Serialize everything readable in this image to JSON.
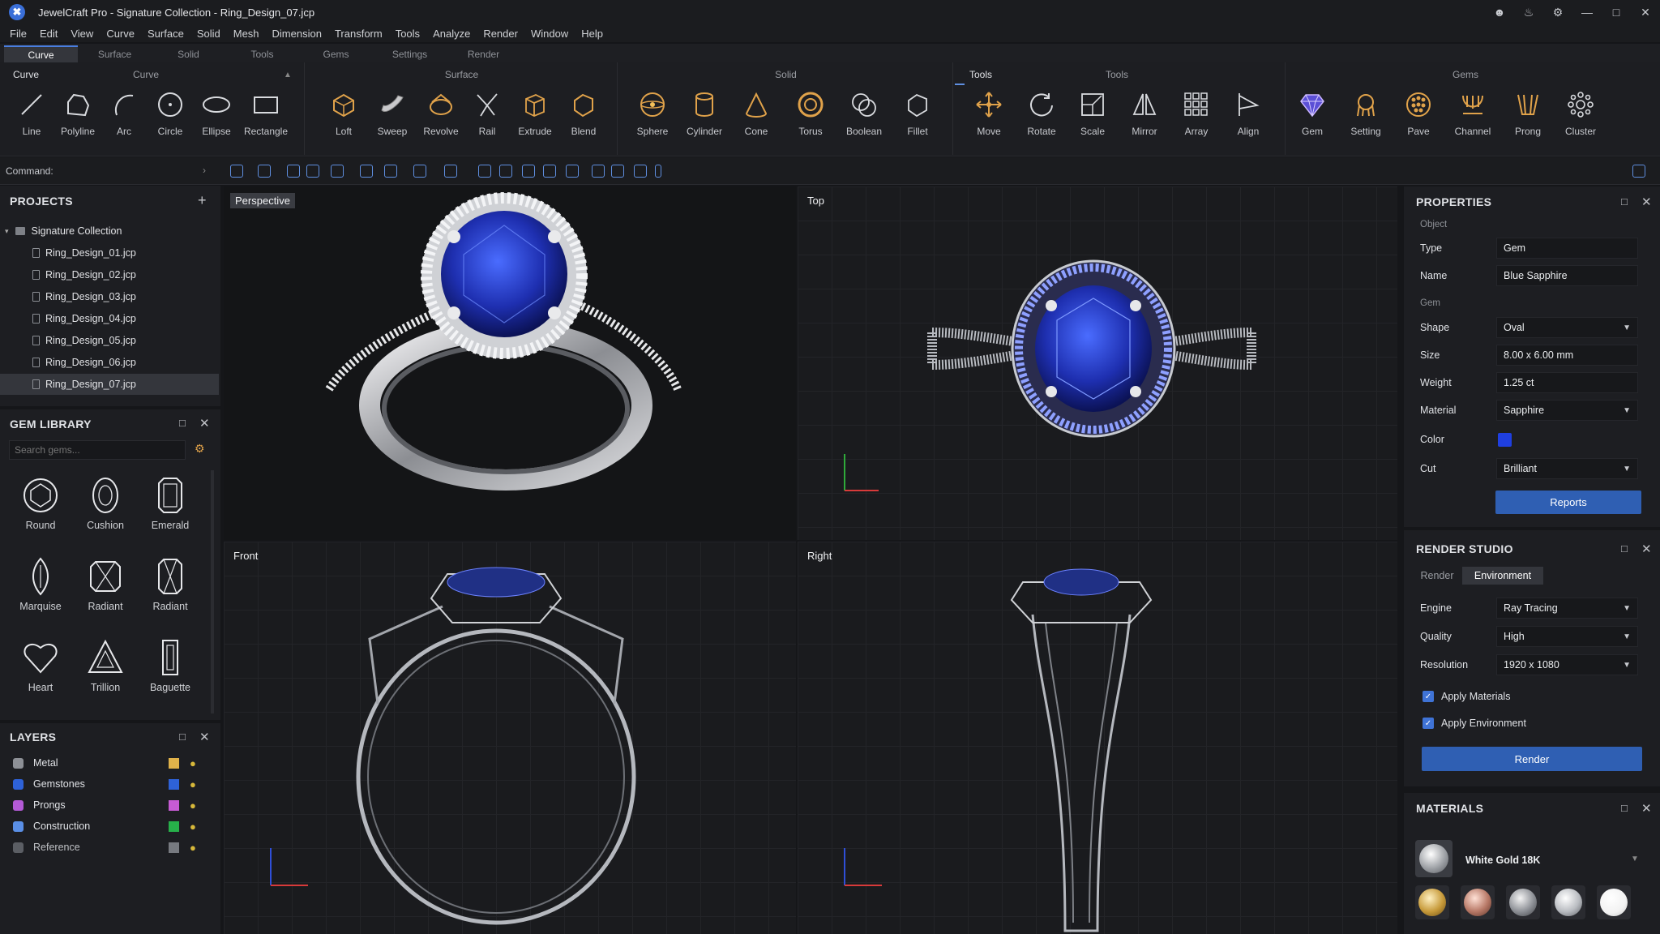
{
  "app": {
    "window_title": "JewelCraft Pro - Signature Collection - Ring_Design_07.jcp",
    "logo_icon": "jewelcraft-logo-icon"
  },
  "menu": [
    "File",
    "Edit",
    "View",
    "Curve",
    "Surface",
    "Solid",
    "Mesh",
    "Dimension",
    "Transform",
    "Tools",
    "Analyze",
    "Render",
    "Window",
    "Help"
  ],
  "ribbon_tabs": [
    {
      "label": "Curve",
      "active": true
    },
    {
      "label": "Surface"
    },
    {
      "label": "Solid"
    },
    {
      "label": "Tools"
    },
    {
      "label": "Gems"
    },
    {
      "label": "Settings"
    },
    {
      "label": "Render"
    }
  ],
  "ribbon": {
    "curve_tab": "Curve",
    "curve_title": "Curve",
    "curve": [
      "Line",
      "Polyline",
      "Arc",
      "Circle",
      "Ellipse",
      "Rectangle"
    ],
    "surface_title": "Surface",
    "surface": [
      "Loft",
      "Sweep",
      "Revolve",
      "Rail",
      "Extrude",
      "Blend"
    ],
    "solid_title": "Solid",
    "solid": [
      "Sphere",
      "Cylinder",
      "Cone",
      "Torus",
      "Boolean",
      "Fillet"
    ],
    "tools_tab": "Tools",
    "tools_title": "Tools",
    "tools": [
      "Move",
      "Rotate",
      "Scale",
      "Mirror",
      "Array",
      "Align"
    ],
    "gems_title": "Gems",
    "gems": [
      "Gem",
      "Setting",
      "Pave",
      "Channel",
      "Prong",
      "Cluster"
    ]
  },
  "command": {
    "label": "Command:"
  },
  "projects": {
    "title": "PROJECTS",
    "collection": "Signature Collection",
    "files": [
      "Ring_Design_01.jcp",
      "Ring_Design_02.jcp",
      "Ring_Design_03.jcp",
      "Ring_Design_04.jcp",
      "Ring_Design_05.jcp",
      "Ring_Design_06.jcp",
      "Ring_Design_07.jcp"
    ],
    "selected_index": 6
  },
  "gem_library": {
    "title": "GEM LIBRARY",
    "search_placeholder": "Search gems...",
    "gems": [
      "Round",
      "Cushion",
      "Emerald",
      "Marquise",
      "Radiant",
      "Radiant",
      "Heart",
      "Trillion",
      "Baguette"
    ]
  },
  "layers": {
    "title": "LAYERS",
    "items": [
      {
        "name": "Metal",
        "color": "#e0b24a",
        "dot": "#8d9096"
      },
      {
        "name": "Gemstones",
        "color": "#2e62d8",
        "dot": "#2e62d8"
      },
      {
        "name": "Prongs",
        "color": "#c65bd4",
        "dot": "#b35ad6"
      },
      {
        "name": "Construction",
        "color": "#27b04a",
        "dot": "#5a8fe6"
      },
      {
        "name": "Reference",
        "color": "#777a80",
        "dot": "#5b5e64"
      }
    ]
  },
  "viewports": {
    "perspective": "Perspective",
    "top": "Top",
    "front": "Front",
    "right": "Right"
  },
  "properties": {
    "title": "PROPERTIES",
    "object_section": "Object",
    "gem_section": "Gem",
    "type_label": "Type",
    "type": "Gem",
    "name_label": "Name",
    "name": "Blue Sapphire",
    "shape_label": "Shape",
    "shape": "Oval",
    "size_label": "Size",
    "size": "8.00 x 6.00 mm",
    "weight_label": "Weight",
    "weight": "1.25 ct",
    "material_label": "Material",
    "material": "Sapphire",
    "color_label": "Color",
    "color_value": "#1f3fe0",
    "cut_label": "Cut",
    "cut": "Brilliant",
    "reports_button": "Reports"
  },
  "render_studio": {
    "title": "RENDER STUDIO",
    "tabs": [
      "Render",
      "Environment"
    ],
    "engine_label": "Engine",
    "engine": "Ray Tracing",
    "quality_label": "Quality",
    "quality": "High",
    "resolution_label": "Resolution",
    "resolution": "1920 x 1080",
    "apply_materials": "Apply Materials",
    "apply_environment": "Apply Environment",
    "render_button": "Render"
  },
  "materials": {
    "title": "MATERIALS",
    "current": "White Gold 18K",
    "swatches": [
      {
        "name": "yellow-gold",
        "color": "#c79a3a"
      },
      {
        "name": "rose-gold",
        "color": "#b77866"
      },
      {
        "name": "silver",
        "color": "#8d9096"
      },
      {
        "name": "platinum",
        "color": "#b9bcc1"
      },
      {
        "name": "white",
        "color": "#f2f2f2"
      }
    ]
  }
}
